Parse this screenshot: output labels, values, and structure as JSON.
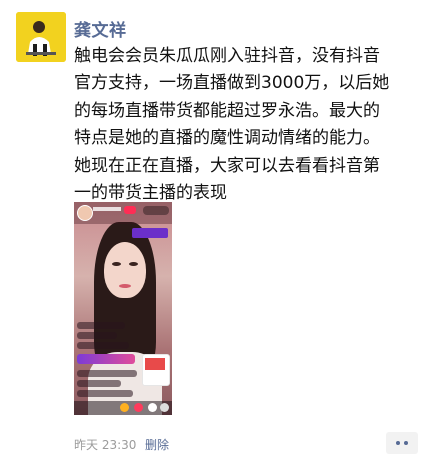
{
  "post": {
    "author": "龚文祥",
    "content_lines": [
      "触电会会员朱瓜瓜刚入驻抖音，没有抖音",
      "官方支持，一场直播做到3000万，以后她",
      "的每场直播带货都能超过罗永浩。最大的",
      "特点是她的直播的魔性调动情绪的能力。",
      "她现在正在直播，大家可以去看看抖音第",
      "一的带货主播的表现"
    ],
    "time": "昨天 23:30",
    "delete_label": "删除"
  },
  "colors": {
    "link": "#576b95",
    "text": "#111111",
    "meta": "#9b9b9b",
    "avatar_bg": "#f2d21f"
  }
}
